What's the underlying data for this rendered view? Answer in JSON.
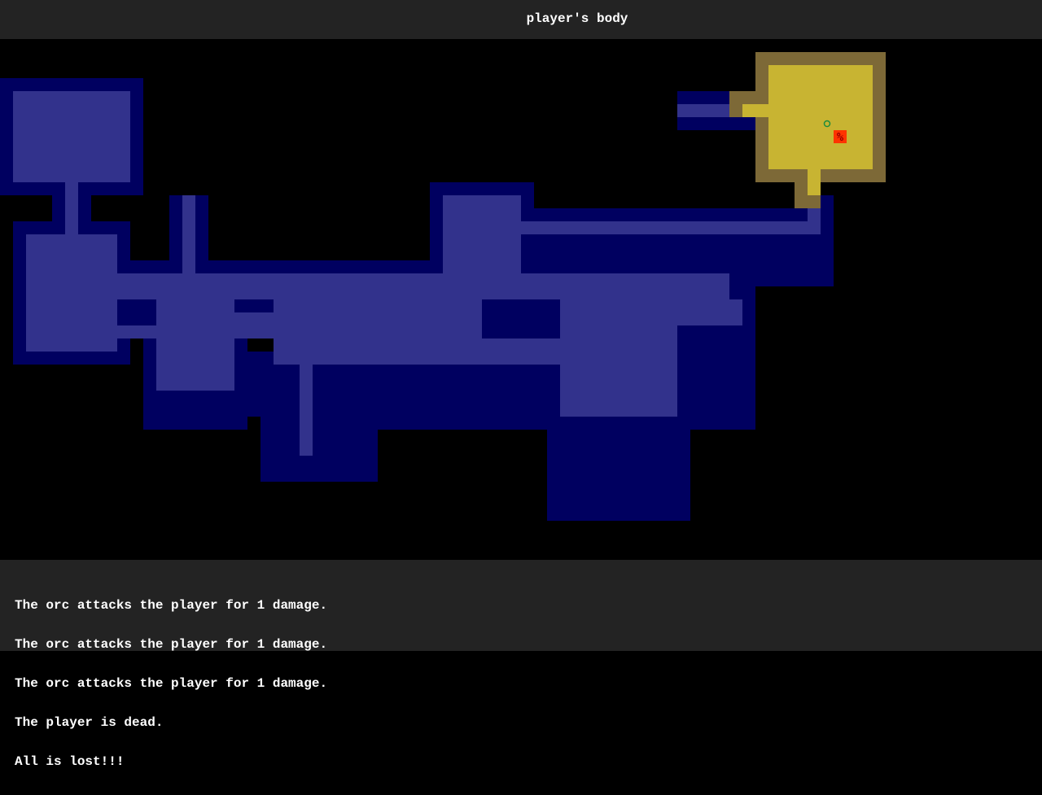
{
  "header": {
    "title": "player's body"
  },
  "map": {
    "colors": {
      "wall_dark": "#000060",
      "floor_dark": "#32328c",
      "wall_lit": "#7d6937",
      "floor_lit": "#c8b432",
      "background": "#000000"
    },
    "entities": [
      {
        "type": "corpse",
        "glyph": "%",
        "color": "#ff2020",
        "bg": "#ff3300"
      },
      {
        "type": "item",
        "glyph": "o",
        "color": "#1e8c3c"
      }
    ]
  },
  "log": {
    "messages": [
      "The orc attacks the player for 1 damage.",
      "The orc attacks the player for 1 damage.",
      "The orc attacks the player for 1 damage.",
      "The player is dead.",
      "All is lost!!!"
    ]
  }
}
